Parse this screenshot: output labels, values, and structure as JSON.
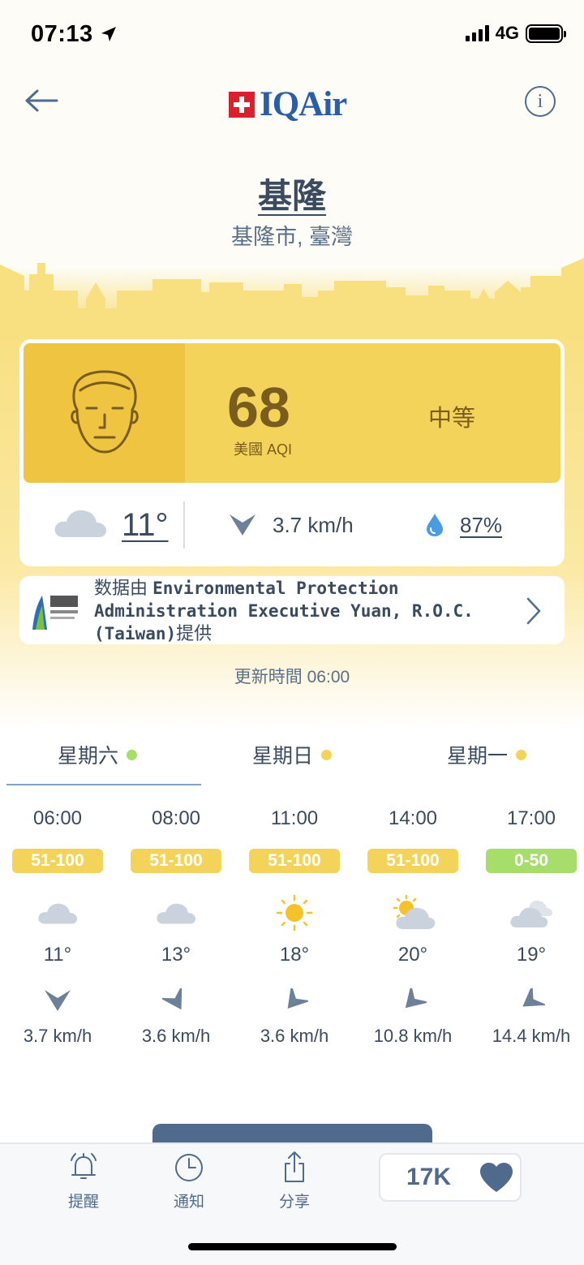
{
  "status_bar": {
    "time": "07:13",
    "network": "4G"
  },
  "header": {
    "brand": "IQAir",
    "info_label": "i"
  },
  "location": {
    "city": "基隆",
    "region": "基隆市, 臺灣"
  },
  "aqi": {
    "value": "68",
    "label": "美國 AQI",
    "level": "中等",
    "color": "#f4d35b"
  },
  "current_weather": {
    "temperature": "11°",
    "wind": "3.7 km/h",
    "humidity": "87%"
  },
  "source": {
    "prefix": "数据由 ",
    "name": "Environmental Protection Administration Executive Yuan, R.O.C. (Taiwan)",
    "suffix": "提供"
  },
  "updated": "更新時間 06:00",
  "day_tabs": [
    {
      "label": "星期六",
      "dot_color": "#a6dd6b"
    },
    {
      "label": "星期日",
      "dot_color": "#f4d35b"
    },
    {
      "label": "星期一",
      "dot_color": "#f4d35b"
    }
  ],
  "forecast": [
    {
      "time": "06:00",
      "aqi": "51-100",
      "icon": "cloud-icon",
      "temp": "11°",
      "wind": "3.7 km/h"
    },
    {
      "time": "08:00",
      "aqi": "51-100",
      "icon": "cloud-icon",
      "temp": "13°",
      "wind": "3.6 km/h"
    },
    {
      "time": "11:00",
      "aqi": "51-100",
      "icon": "sun-icon",
      "temp": "18°",
      "wind": "3.6 km/h"
    },
    {
      "time": "14:00",
      "aqi": "51-100",
      "icon": "partly-cloudy-icon",
      "temp": "20°",
      "wind": "10.8 km/h"
    },
    {
      "time": "17:00",
      "aqi": "0-50",
      "icon": "cloudy-icon",
      "temp": "19°",
      "wind": "14.4 km/h"
    }
  ],
  "bottom_nav": {
    "alerts": "提醒",
    "notifications": "通知",
    "share": "分享",
    "followers": "17K"
  }
}
